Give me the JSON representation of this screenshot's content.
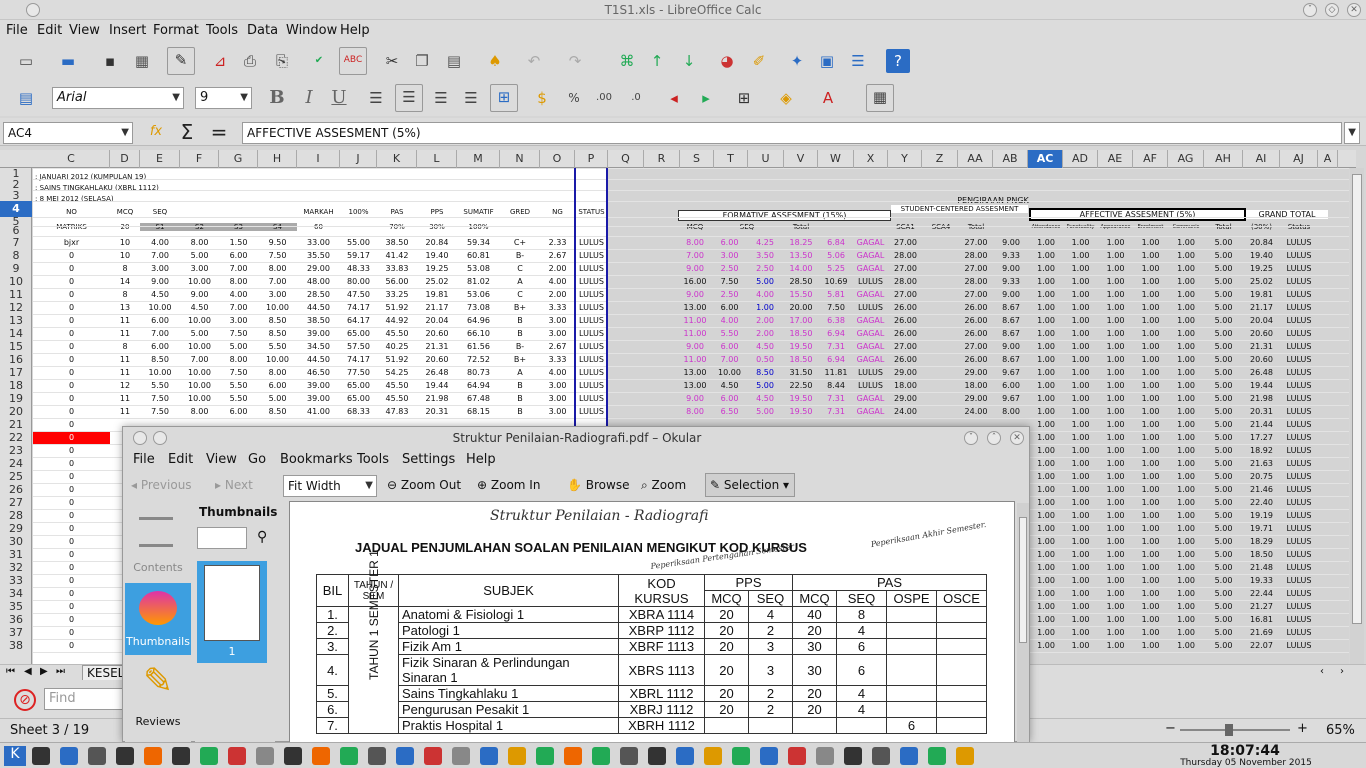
{
  "window": {
    "title": "T1S1.xls - LibreOffice Calc"
  },
  "menu": [
    "File",
    "Edit",
    "View",
    "Insert",
    "Format",
    "Tools",
    "Data",
    "Window",
    "Help"
  ],
  "font": {
    "name": "Arial",
    "size": "9"
  },
  "formula": {
    "cellref": "AC4",
    "content": "AFFECTIVE ASSESMENT (5%)"
  },
  "columns": [
    "C",
    "D",
    "E",
    "F",
    "G",
    "H",
    "I",
    "J",
    "K",
    "L",
    "M",
    "N",
    "O",
    "P",
    "Q",
    "R",
    "S",
    "T",
    "U",
    "V",
    "W",
    "X",
    "Y",
    "Z",
    "AA",
    "AB",
    "AC",
    "AD",
    "AE",
    "AF",
    "AG",
    "AH",
    "AI",
    "AJ",
    "A"
  ],
  "rows": [
    "1",
    "2",
    "3",
    "4",
    "5",
    "6",
    "7",
    "8",
    "9",
    "10",
    "11",
    "12",
    "13",
    "14",
    "15",
    "16",
    "17",
    "18",
    "19",
    "20",
    "21",
    "22",
    "23",
    "24",
    "25",
    "26",
    "27",
    "28",
    "29",
    "30",
    "31",
    "32",
    "33",
    "34",
    "35",
    "36",
    "37",
    "38"
  ],
  "sheet_top": [
    ": JANUARI 2012 (KUMPULAN 19)",
    ": SAINS TINGKAHLAKU (XBRL 1112)",
    ": 8 MEI 2012 (SELASA)"
  ],
  "left_headers": {
    "no": "NO",
    "matriks": "MATRIKS",
    "mcq": "MCQ",
    "mcq20": "20",
    "seq": "SEQ",
    "s1": "S1",
    "s2": "S2",
    "s3": "S3",
    "s4": "S4",
    "ten": "10",
    "markah": "MARKAH",
    "m60": "60",
    "p100": "100%",
    "pas": "PAS",
    "p70": "70%",
    "pps": "PPS",
    "p30": "30%",
    "sumatif": "SUMATIF",
    "gred": "GRED",
    "ng": "NG",
    "status": "STATUS"
  },
  "left_rows": [
    [
      "bjxr",
      "10",
      "4.00",
      "8.00",
      "1.50",
      "9.50",
      "33.00",
      "55.00",
      "38.50",
      "20.84",
      "59.34",
      "C+",
      "2.33",
      "LULUS"
    ],
    [
      "0",
      "10",
      "7.00",
      "5.00",
      "6.00",
      "7.50",
      "35.50",
      "59.17",
      "41.42",
      "19.40",
      "60.81",
      "B-",
      "2.67",
      "LULUS"
    ],
    [
      "0",
      "8",
      "3.00",
      "3.00",
      "7.00",
      "8.00",
      "29.00",
      "48.33",
      "33.83",
      "19.25",
      "53.08",
      "C",
      "2.00",
      "LULUS"
    ],
    [
      "0",
      "14",
      "9.00",
      "10.00",
      "8.00",
      "7.00",
      "48.00",
      "80.00",
      "56.00",
      "25.02",
      "81.02",
      "A",
      "4.00",
      "LULUS"
    ],
    [
      "0",
      "8",
      "4.50",
      "9.00",
      "4.00",
      "3.00",
      "28.50",
      "47.50",
      "33.25",
      "19.81",
      "53.06",
      "C",
      "2.00",
      "LULUS"
    ],
    [
      "0",
      "13",
      "10.00",
      "4.50",
      "7.00",
      "10.00",
      "44.50",
      "74.17",
      "51.92",
      "21.17",
      "73.08",
      "B+",
      "3.33",
      "LULUS"
    ],
    [
      "0",
      "11",
      "6.00",
      "10.00",
      "3.00",
      "8.50",
      "38.50",
      "64.17",
      "44.92",
      "20.04",
      "64.96",
      "B",
      "3.00",
      "LULUS"
    ],
    [
      "0",
      "11",
      "7.00",
      "5.00",
      "7.50",
      "8.50",
      "39.00",
      "65.00",
      "45.50",
      "20.60",
      "66.10",
      "B",
      "3.00",
      "LULUS"
    ],
    [
      "0",
      "8",
      "6.00",
      "10.00",
      "5.00",
      "5.50",
      "34.50",
      "57.50",
      "40.25",
      "21.31",
      "61.56",
      "B-",
      "2.67",
      "LULUS"
    ],
    [
      "0",
      "11",
      "8.50",
      "7.00",
      "8.00",
      "10.00",
      "44.50",
      "74.17",
      "51.92",
      "20.60",
      "72.52",
      "B+",
      "3.33",
      "LULUS"
    ],
    [
      "0",
      "11",
      "10.00",
      "10.00",
      "7.50",
      "8.00",
      "46.50",
      "77.50",
      "54.25",
      "26.48",
      "80.73",
      "A",
      "4.00",
      "LULUS"
    ],
    [
      "0",
      "12",
      "5.50",
      "10.00",
      "5.50",
      "6.00",
      "39.00",
      "65.00",
      "45.50",
      "19.44",
      "64.94",
      "B",
      "3.00",
      "LULUS"
    ],
    [
      "0",
      "11",
      "7.50",
      "10.00",
      "5.50",
      "5.00",
      "39.00",
      "65.00",
      "45.50",
      "21.98",
      "67.48",
      "B",
      "3.00",
      "LULUS"
    ],
    [
      "0",
      "11",
      "7.50",
      "8.00",
      "6.00",
      "8.50",
      "41.00",
      "68.33",
      "47.83",
      "20.31",
      "68.15",
      "B",
      "3.00",
      "LULUS"
    ]
  ],
  "extra_zeros": [
    "0",
    "0",
    "0",
    "0",
    "0",
    "0",
    "0",
    "0",
    "0",
    "0",
    "0",
    "0",
    "0",
    "0",
    "0",
    "0",
    "0",
    "0"
  ],
  "right_headers": {
    "pengiraan": "PENGIRAAN PNGK",
    "formative": "FORMATIVE ASSESMENT (15%)",
    "student": "STUDENT-CENTERED ASSESMENT",
    "affective": "AFFECTIVE ASSESMENT (5%)",
    "grand": "GRAND TOTAL",
    "mcq": "MCQ",
    "seq": "SEQ",
    "total": "Total",
    "sca1": "SCA1",
    "sca4": "SCA4",
    "p30": "(30%)",
    "status": "Status",
    "attendance": "Attendance",
    "punctuality": "Punctuality",
    "appearance": "Appearance",
    "enrolment": "Enrolment",
    "communic": "Communic",
    "total5": "Total"
  },
  "right_rows": [
    [
      "8.00",
      "6.00",
      "4.25",
      "18.25",
      "6.84",
      "GAGAL",
      "27.00",
      "27.00",
      "9.00",
      "20.84",
      "LULUS"
    ],
    [
      "7.00",
      "3.00",
      "3.50",
      "13.50",
      "5.06",
      "GAGAL",
      "28.00",
      "28.00",
      "9.33",
      "19.40",
      "LULUS"
    ],
    [
      "9.00",
      "2.50",
      "2.50",
      "14.00",
      "5.25",
      "GAGAL",
      "27.00",
      "27.00",
      "9.00",
      "19.25",
      "LULUS"
    ],
    [
      "16.00",
      "7.50",
      "5.00",
      "28.50",
      "10.69",
      "LULUS",
      "28.00",
      "28.00",
      "9.33",
      "25.02",
      "LULUS"
    ],
    [
      "9.00",
      "2.50",
      "4.00",
      "15.50",
      "5.81",
      "GAGAL",
      "27.00",
      "27.00",
      "9.00",
      "19.81",
      "LULUS"
    ],
    [
      "13.00",
      "6.00",
      "1.00",
      "20.00",
      "7.50",
      "LULUS",
      "26.00",
      "26.00",
      "8.67",
      "21.17",
      "LULUS"
    ],
    [
      "11.00",
      "4.00",
      "2.00",
      "17.00",
      "6.38",
      "GAGAL",
      "26.00",
      "26.00",
      "8.67",
      "20.04",
      "LULUS"
    ],
    [
      "11.00",
      "5.50",
      "2.00",
      "18.50",
      "6.94",
      "GAGAL",
      "26.00",
      "26.00",
      "8.67",
      "20.60",
      "LULUS"
    ],
    [
      "9.00",
      "6.00",
      "4.50",
      "19.50",
      "7.31",
      "GAGAL",
      "27.00",
      "27.00",
      "9.00",
      "21.31",
      "LULUS"
    ],
    [
      "11.00",
      "7.00",
      "0.50",
      "18.50",
      "6.94",
      "GAGAL",
      "26.00",
      "26.00",
      "8.67",
      "20.60",
      "LULUS"
    ],
    [
      "13.00",
      "10.00",
      "8.50",
      "31.50",
      "11.81",
      "LULUS",
      "29.00",
      "29.00",
      "9.67",
      "26.48",
      "LULUS"
    ],
    [
      "13.00",
      "4.50",
      "5.00",
      "22.50",
      "8.44",
      "LULUS",
      "18.00",
      "18.00",
      "6.00",
      "19.44",
      "LULUS"
    ],
    [
      "9.00",
      "6.00",
      "4.50",
      "19.50",
      "7.31",
      "GAGAL",
      "29.00",
      "29.00",
      "9.67",
      "21.98",
      "LULUS"
    ],
    [
      "8.00",
      "6.50",
      "5.00",
      "19.50",
      "7.31",
      "GAGAL",
      "24.00",
      "24.00",
      "8.00",
      "20.31",
      "LULUS"
    ]
  ],
  "right_extra_totals": [
    "21.44",
    "17.27",
    "18.92",
    "21.63",
    "20.75",
    "21.46",
    "22.40",
    "19.19",
    "19.71",
    "18.29",
    "18.50",
    "21.48",
    "19.33",
    "22.44",
    "21.27",
    "16.81",
    "21.69",
    "22.07"
  ],
  "status": {
    "sheet": "Sheet 3 / 19",
    "zoom": "65%",
    "sheet_tab": "KESEL",
    "find_placeholder": "Find"
  },
  "okular": {
    "title": "Struktur Penilaian-Radiografi.pdf – Okular",
    "menu": [
      "File",
      "Edit",
      "View",
      "Go",
      "Bookmarks",
      "Tools",
      "Settings",
      "Help"
    ],
    "toolbar": {
      "previous": "Previous",
      "next": "Next",
      "fit": "Fit Width",
      "zoom_out": "Zoom Out",
      "zoom_in": "Zoom In",
      "browse": "Browse",
      "zoom": "Zoom",
      "selection": "Selection"
    },
    "side": {
      "contents": "Contents",
      "thumbnails": "Thumbnails",
      "reviews": "Reviews"
    },
    "thumbs_title": "Thumbnails",
    "page_number": "1",
    "doc": {
      "handwritten_title": "Struktur Penilaian - Radiografi",
      "title": "JADUAL PENJUMLAHAN SOALAN PENILAIAN MENGIKUT KOD KURSUS",
      "note1": "Peperiksaan Pertengahan Semester",
      "note2": "Peperiksaan Akhir Semester.",
      "headers": {
        "bil": "BIL",
        "tahun": "TAHUN / SEM",
        "subjek": "SUBJEK",
        "kod": "KOD KURSUS",
        "pps": "PPS",
        "pas": "PAS",
        "mcq": "MCQ",
        "seq": "SEQ",
        "ospe": "OSPE",
        "osce": "OSCE"
      },
      "year_label": "TAHUN 1 SEMESTER 1",
      "rows": [
        [
          "1.",
          "Anatomi & Fisiologi 1",
          "XBRA 1114",
          "20",
          "4",
          "40",
          "8",
          "",
          ""
        ],
        [
          "2.",
          "Patologi 1",
          "XBRP 1112",
          "20",
          "2",
          "20",
          "4",
          "",
          ""
        ],
        [
          "3.",
          "Fizik Am 1",
          "XBRF 1113",
          "20",
          "3",
          "30",
          "6",
          "",
          ""
        ],
        [
          "4.",
          "Fizik Sinaran & Perlindungan Sinaran 1",
          "XBRS 1113",
          "20",
          "3",
          "30",
          "6",
          "",
          ""
        ],
        [
          "5.",
          "Sains Tingkahlaku 1",
          "XBRL 1112",
          "20",
          "2",
          "20",
          "4",
          "",
          ""
        ],
        [
          "6.",
          "Pengurusan Pesakit 1",
          "XBRJ 1112",
          "20",
          "2",
          "20",
          "4",
          "",
          ""
        ],
        [
          "7.",
          "Praktis Hospital 1",
          "XBRH 1112",
          "",
          "",
          "",
          "",
          "6",
          ""
        ]
      ]
    }
  },
  "clock": {
    "time": "18:07:44",
    "date": "Thursday 05 November 2015"
  },
  "colors": {
    "pink": "#cc33cc",
    "red": "#ff0000",
    "blue": "#0000cc",
    "selection": "#3399ff"
  }
}
